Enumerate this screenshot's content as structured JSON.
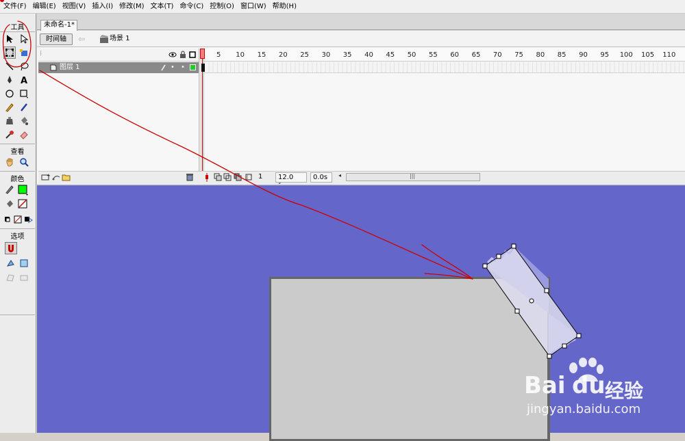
{
  "menu": [
    "文件(F)",
    "编辑(E)",
    "视图(V)",
    "插入(I)",
    "修改(M)",
    "文本(T)",
    "命令(C)",
    "控制(O)",
    "窗口(W)",
    "帮助(H)"
  ],
  "tools_panel": {
    "title": "工具",
    "sections": {
      "view": "查看",
      "colors": "颜色",
      "options": "选项"
    },
    "stroke_color": "#000000",
    "fill_color": "#00ff00"
  },
  "document": {
    "tab_title": "未命名-1*",
    "timeline_button": "时间轴",
    "scene_label": "场景 1"
  },
  "timeline": {
    "frame_numbers": [
      "5",
      "10",
      "15",
      "20",
      "25",
      "30",
      "35",
      "40",
      "45",
      "50",
      "55",
      "60",
      "65",
      "70",
      "75",
      "80",
      "85",
      "90",
      "95",
      "100",
      "105",
      "110"
    ],
    "layer_name": "图层 1",
    "current_frame": "1",
    "frame_rate": "12.0 fps",
    "elapsed_time": "0.0s"
  },
  "stage": {
    "background_color": "#6566c9",
    "canvas_color": "#cbcbcb"
  },
  "watermark": {
    "brand": "Bai",
    "brand2": "du",
    "brand_suffix": "经验",
    "url": "jingyan.baidu.com"
  },
  "annotation": {
    "color": "#cc0000"
  }
}
